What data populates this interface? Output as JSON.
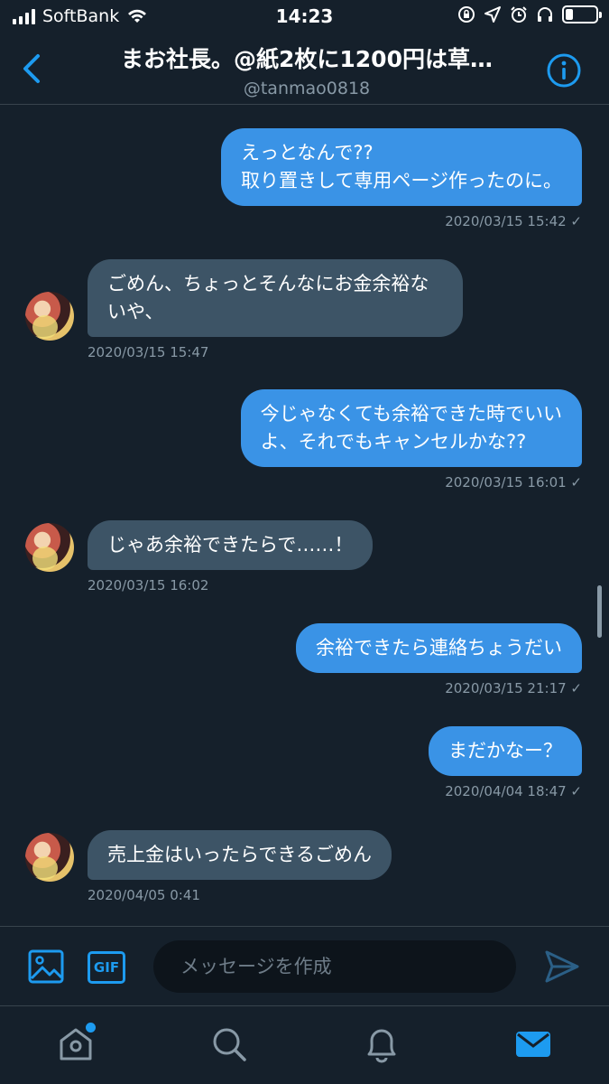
{
  "status_bar": {
    "carrier": "SoftBank",
    "time": "14:23",
    "icons": [
      "signal-icon",
      "wifi-icon",
      "orientation-lock-icon",
      "location-icon",
      "alarm-icon",
      "headphones-icon",
      "battery-icon"
    ]
  },
  "header": {
    "title": "まお社長。@紙2枚に1200円は草…",
    "handle": "@tanmao0818",
    "back_icon": "back-chevron-icon",
    "info_icon": "info-icon"
  },
  "messages": [
    {
      "direction": "out",
      "lines": [
        "えっとなんで??",
        "取り置きして専用ページ作ったのに。"
      ],
      "timestamp": "2020/03/15 15:42 ✓"
    },
    {
      "direction": "in",
      "lines": [
        "ごめん、ちょっとそんなにお金余裕な",
        "いや、"
      ],
      "timestamp": "2020/03/15 15:47"
    },
    {
      "direction": "out",
      "lines": [
        "今じゃなくても余裕できた時でいい",
        "よ、それでもキャンセルかな??"
      ],
      "timestamp": "2020/03/15 16:01 ✓"
    },
    {
      "direction": "in",
      "lines": [
        "じゃあ余裕できたらで……！"
      ],
      "timestamp": "2020/03/15 16:02"
    },
    {
      "direction": "out",
      "lines": [
        "余裕できたら連絡ちょうだい"
      ],
      "timestamp": "2020/03/15 21:17 ✓"
    },
    {
      "direction": "out",
      "lines": [
        "まだかなー？"
      ],
      "timestamp": "2020/04/04 18:47 ✓"
    },
    {
      "direction": "in",
      "lines": [
        "売上金はいったらできるごめん"
      ],
      "timestamp": "2020/04/05 0:41"
    }
  ],
  "composer": {
    "placeholder": "メッセージを作成",
    "gif_label": "GIF"
  },
  "tabbar": {
    "items": [
      "home-icon",
      "search-icon",
      "notifications-icon",
      "messages-icon"
    ],
    "active": "messages-icon"
  },
  "colors": {
    "background": "#15202b",
    "accent": "#1d9bf0",
    "outgoing_bubble": "#3a93e6",
    "incoming_bubble": "#3d5466",
    "secondary_text": "#8899a6"
  }
}
